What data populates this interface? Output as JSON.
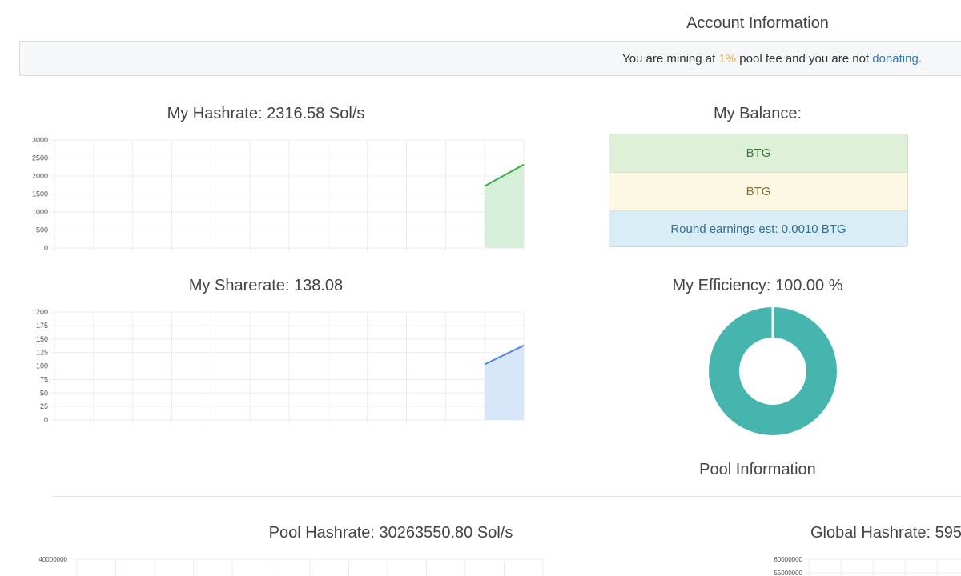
{
  "account": {
    "title": "Account Information",
    "notice": {
      "prefix": "You are mining at ",
      "fee": "1%",
      "middle": " pool fee and you are not ",
      "link": "donating",
      "suffix": "."
    }
  },
  "my_hashrate": {
    "title": "My Hashrate: 2316.58 Sol/s"
  },
  "my_sharerate": {
    "title": "My Sharerate: 138.08"
  },
  "balance": {
    "title": "My Balance:",
    "rows": [
      "BTG",
      "BTG",
      "Round earnings est: 0.0010 BTG"
    ]
  },
  "efficiency": {
    "title": "My Efficiency: 100.00 %"
  },
  "pool": {
    "title": "Pool Information",
    "hashrate_title": "Pool Hashrate: 30263550.80 Sol/s",
    "global_title": "Global Hashrate: 595"
  },
  "colors": {
    "hashrate_line": "#3bab48",
    "hashrate_fill": "#d6efd8",
    "sharerate_line": "#4a88d8",
    "sharerate_fill": "#d8e6fa",
    "efficiency": "#45b5ad"
  },
  "chart_data": [
    {
      "type": "area",
      "name_ref": "my_hashrate",
      "yticks": [
        0,
        500,
        1000,
        1500,
        2000,
        2500,
        3000
      ],
      "ylim": [
        0,
        3000
      ],
      "x": [
        11,
        12
      ],
      "values": [
        1720,
        2316.58
      ],
      "grid": true
    },
    {
      "type": "area",
      "name_ref": "my_sharerate",
      "yticks": [
        0,
        25,
        50,
        75,
        100,
        125,
        150,
        175,
        200
      ],
      "ylim": [
        0,
        200
      ],
      "x": [
        11,
        12
      ],
      "values": [
        103,
        138.08
      ],
      "grid": true
    },
    {
      "type": "pie",
      "name_ref": "efficiency",
      "values": [
        100
      ],
      "donut": true
    },
    {
      "type": "area",
      "name_ref": "pool_hashrate",
      "yticks": [
        "40000000"
      ],
      "grid": true
    },
    {
      "type": "area",
      "name_ref": "global_hashrate",
      "yticks": [
        "60000000",
        "55000000"
      ],
      "grid": true
    }
  ]
}
